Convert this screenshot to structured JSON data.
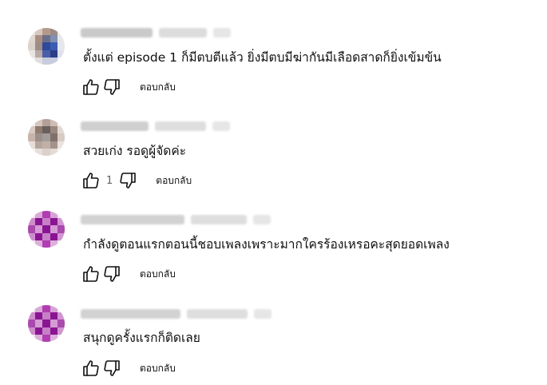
{
  "comments": [
    {
      "author": "",
      "text": "ตั้งแต่ episode 1 ก็มีตบตีแล้ว ยิ่งมีตบมีฆ่ากันมีเลือดสาดก็ยิ่งเข้มข้น",
      "likes": "",
      "reply_label": "ตอบกลับ",
      "avatar_colors": [
        "#e6e2e0",
        "#d9c8be",
        "#b49a8b",
        "#9c8a86",
        "#e9e6e6",
        "#e1d7d2",
        "#a98e80",
        "#6d6e8a",
        "#8091b0",
        "#e8e8eb",
        "#dcd2cc",
        "#9e8c86",
        "#2f4a9a",
        "#3c5bb2",
        "#e5e7ee",
        "#e9e5e3",
        "#b8aaa4",
        "#4b5fa8",
        "#2b3f88",
        "#dfe2ea",
        "#f2f2f2",
        "#e3dfde",
        "#c9ccdc",
        "#c6cde0",
        "#f2f2f2"
      ]
    },
    {
      "author": "",
      "text": "สวยเก่ง รอดูผู้จัดค่ะ",
      "likes": "1",
      "reply_label": "ตอบกลับ",
      "avatar_colors": [
        "#f3efed",
        "#d6c7c0",
        "#b49f96",
        "#cdbdb5",
        "#f3f0ee",
        "#d9c9c1",
        "#8f7a70",
        "#6b5f5c",
        "#9a8880",
        "#e2d8d3",
        "#c7b3a9",
        "#9b8f8c",
        "#a39c9b",
        "#7e706b",
        "#d8cbc4",
        "#e8ddd8",
        "#b6a59d",
        "#c0b0a8",
        "#a4928a",
        "#ebe3df",
        "#f5f2f1",
        "#e7dfdb",
        "#dcd0ca",
        "#e4dbd6",
        "#f5f3f2"
      ]
    },
    {
      "author": "",
      "text": "กำลังดูตอนแรกตอนนี้ชอบเพลงเพราะมากใครร้องเหรอคะสุดยอดเพลง",
      "likes": "",
      "reply_label": "ตอบกลับ",
      "avatar_colors": [
        "#f4e4f2",
        "#d9a9d7",
        "#b23db3",
        "#d7a3d6",
        "#f5e6f4",
        "#cf8ccd",
        "#8a1593",
        "#c780c7",
        "#8a1593",
        "#d295d1",
        "#a94aac",
        "#d59bd4",
        "#8a1593",
        "#d59bd4",
        "#a94aac",
        "#cf8ccd",
        "#8a1593",
        "#c780c7",
        "#8a1593",
        "#d295d1",
        "#f4e4f2",
        "#dcb0da",
        "#b23db3",
        "#dcb0da",
        "#f5e6f4"
      ]
    },
    {
      "author": "",
      "text": "สนุกดูครั้งแรกก็ติดเลย",
      "likes": "",
      "reply_label": "ตอบกลับ",
      "avatar_colors": [
        "#f4e4f2",
        "#d9a9d7",
        "#b23db3",
        "#d7a3d6",
        "#f5e6f4",
        "#cf8ccd",
        "#8a1593",
        "#c780c7",
        "#8a1593",
        "#d295d1",
        "#a94aac",
        "#d59bd4",
        "#8a1593",
        "#d59bd4",
        "#a94aac",
        "#cf8ccd",
        "#8a1593",
        "#c780c7",
        "#8a1593",
        "#d295d1",
        "#f4e4f2",
        "#dcb0da",
        "#b23db3",
        "#dcb0da",
        "#f5e6f4"
      ]
    }
  ],
  "icons": {
    "like": "thumbs-up-icon",
    "dislike": "thumbs-down-icon"
  }
}
